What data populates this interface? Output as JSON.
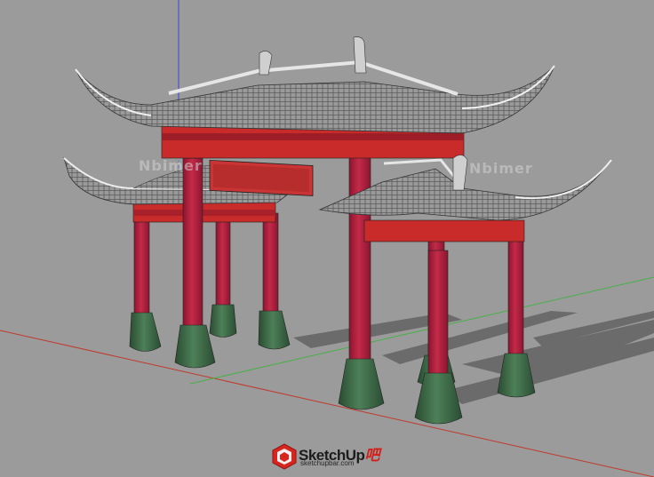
{
  "watermark": {
    "left": "Nbimer",
    "right": "Nbimer"
  },
  "logo": {
    "name": "SketchUp",
    "suffix": "吧",
    "url": "sketchupbar.com"
  },
  "colors": {
    "background": "#9b9b9b",
    "pillar": "#b3203c",
    "base": "#3d6b45",
    "roof": "#8e8e8e",
    "beam": "#c92a2a",
    "axis_red": "#c0392b",
    "axis_green": "#3fa33f",
    "axis_blue": "#3a3ad0"
  }
}
